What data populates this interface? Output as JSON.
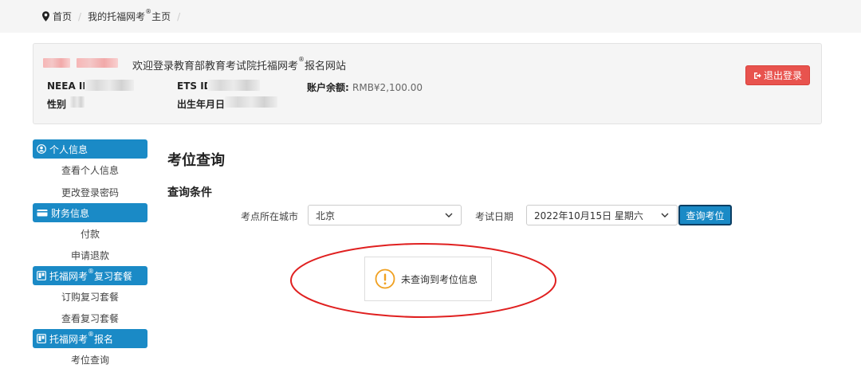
{
  "breadcrumb": {
    "home": "首页",
    "current_prefix": "我的托福网考",
    "current_reg": "®",
    "current_suffix": "主页"
  },
  "user_panel": {
    "welcome_prefix": "欢迎登录教育部教育考试院托福网考",
    "welcome_reg": "®",
    "welcome_suffix": "报名网站",
    "neea_id_label": "NEEA ID",
    "ets_id_label": "ETS ID",
    "balance_label": "账户余额:",
    "balance_value": "RMB¥2,100.00",
    "gender_label": "性别",
    "birth_label": "出生年月日",
    "logout_label": "退出登录"
  },
  "sidebar": {
    "personal": {
      "label": "个人信息",
      "items": [
        "查看个人信息",
        "更改登录密码"
      ]
    },
    "finance": {
      "label": "财务信息",
      "items": [
        "付款",
        "申请退款"
      ]
    },
    "review": {
      "label_prefix": "托福网考",
      "label_reg": "®",
      "label_suffix": "复习套餐",
      "items": [
        "订购复习套餐",
        "查看复习套餐"
      ]
    },
    "register": {
      "label_prefix": "托福网考",
      "label_reg": "®",
      "label_suffix": "报名",
      "items": [
        "考位查询"
      ]
    }
  },
  "main": {
    "title": "考位查询",
    "subtitle": "查询条件",
    "city_label": "考点所在城市",
    "city_value": "北京",
    "date_label": "考试日期",
    "date_value": "2022年10月15日 星期六",
    "query_button": "查询考位",
    "result_message": "未查询到考位信息"
  },
  "colors": {
    "primary": "#1a8ac6",
    "danger": "#e8534e",
    "warning": "#f0a020",
    "annotation": "#e02020"
  }
}
